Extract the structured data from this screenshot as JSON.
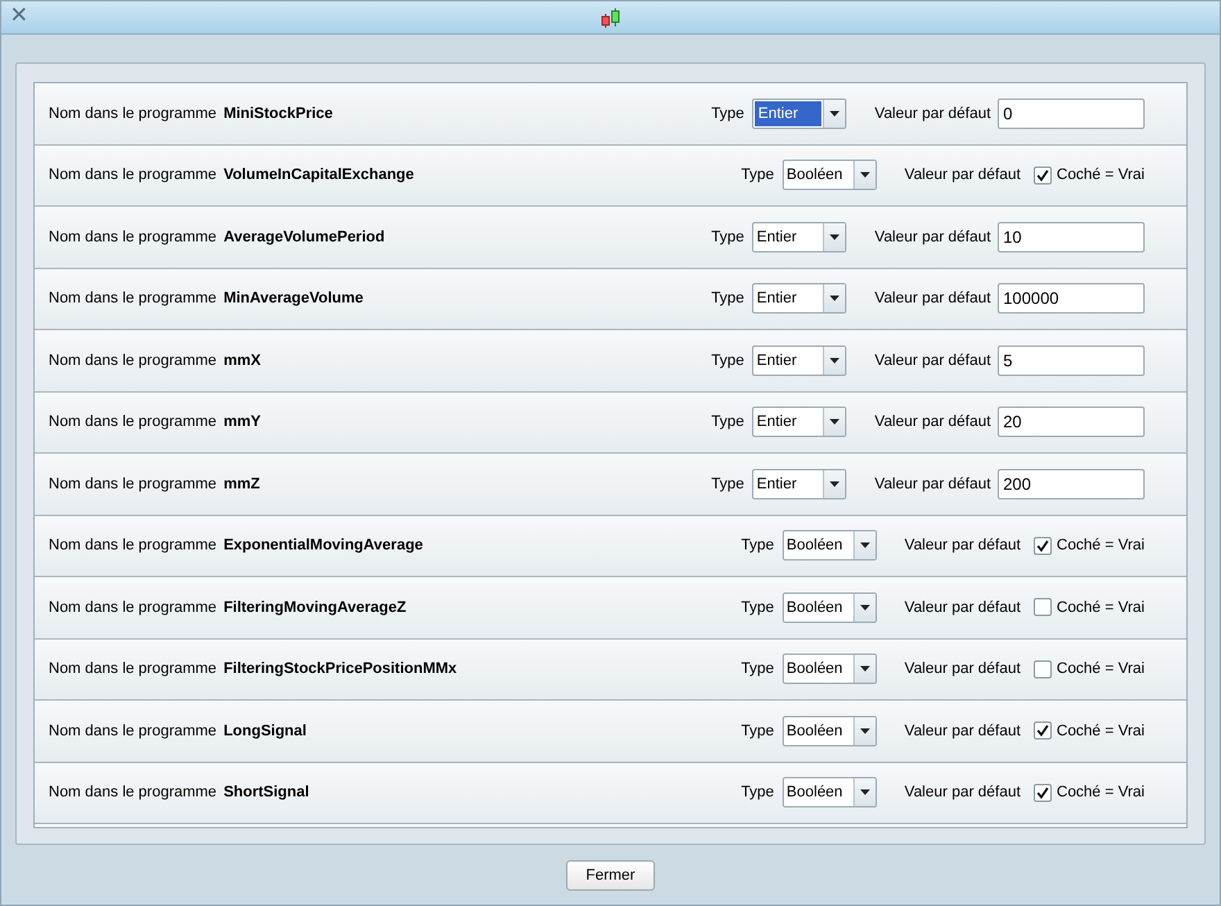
{
  "window": {
    "close_glyph": "✕"
  },
  "rows": [
    {
      "label": "Nom dans le programme",
      "name": "MiniStockPrice",
      "type_label": "Type",
      "type": "Entier",
      "type_focused": true,
      "kind": "integer",
      "default_label": "Valeur par défaut",
      "value": "0"
    },
    {
      "label": "Nom dans le programme",
      "name": "VolumeInCapitalExchange",
      "type_label": "Type",
      "type": "Booléen",
      "type_focused": false,
      "kind": "boolean",
      "default_label": "Valeur par défaut",
      "checked": true,
      "check_label": "Coché = Vrai"
    },
    {
      "label": "Nom dans le programme",
      "name": "AverageVolumePeriod",
      "type_label": "Type",
      "type": "Entier",
      "type_focused": false,
      "kind": "integer",
      "default_label": "Valeur par défaut",
      "value": "10"
    },
    {
      "label": "Nom dans le programme",
      "name": "MinAverageVolume",
      "type_label": "Type",
      "type": "Entier",
      "type_focused": false,
      "kind": "integer",
      "default_label": "Valeur par défaut",
      "value": "100000"
    },
    {
      "label": "Nom dans le programme",
      "name": "mmX",
      "type_label": "Type",
      "type": "Entier",
      "type_focused": false,
      "kind": "integer",
      "default_label": "Valeur par défaut",
      "value": "5"
    },
    {
      "label": "Nom dans le programme",
      "name": "mmY",
      "type_label": "Type",
      "type": "Entier",
      "type_focused": false,
      "kind": "integer",
      "default_label": "Valeur par défaut",
      "value": "20"
    },
    {
      "label": "Nom dans le programme",
      "name": "mmZ",
      "type_label": "Type",
      "type": "Entier",
      "type_focused": false,
      "kind": "integer",
      "default_label": "Valeur par défaut",
      "value": "200"
    },
    {
      "label": "Nom dans le programme",
      "name": "ExponentialMovingAverage",
      "type_label": "Type",
      "type": "Booléen",
      "type_focused": false,
      "kind": "boolean",
      "default_label": "Valeur par défaut",
      "checked": true,
      "check_label": "Coché = Vrai"
    },
    {
      "label": "Nom dans le programme",
      "name": "FilteringMovingAverageZ",
      "type_label": "Type",
      "type": "Booléen",
      "type_focused": false,
      "kind": "boolean",
      "default_label": "Valeur par défaut",
      "checked": false,
      "check_label": "Coché = Vrai"
    },
    {
      "label": "Nom dans le programme",
      "name": "FilteringStockPricePositionMMx",
      "type_label": "Type",
      "type": "Booléen",
      "type_focused": false,
      "kind": "boolean",
      "default_label": "Valeur par défaut",
      "checked": false,
      "check_label": "Coché = Vrai"
    },
    {
      "label": "Nom dans le programme",
      "name": "LongSignal",
      "type_label": "Type",
      "type": "Booléen",
      "type_focused": false,
      "kind": "boolean",
      "default_label": "Valeur par défaut",
      "checked": true,
      "check_label": "Coché = Vrai"
    },
    {
      "label": "Nom dans le programme",
      "name": "ShortSignal",
      "type_label": "Type",
      "type": "Booléen",
      "type_focused": false,
      "kind": "boolean",
      "default_label": "Valeur par défaut",
      "checked": true,
      "check_label": "Coché = Vrai"
    }
  ],
  "close_button": "Fermer"
}
